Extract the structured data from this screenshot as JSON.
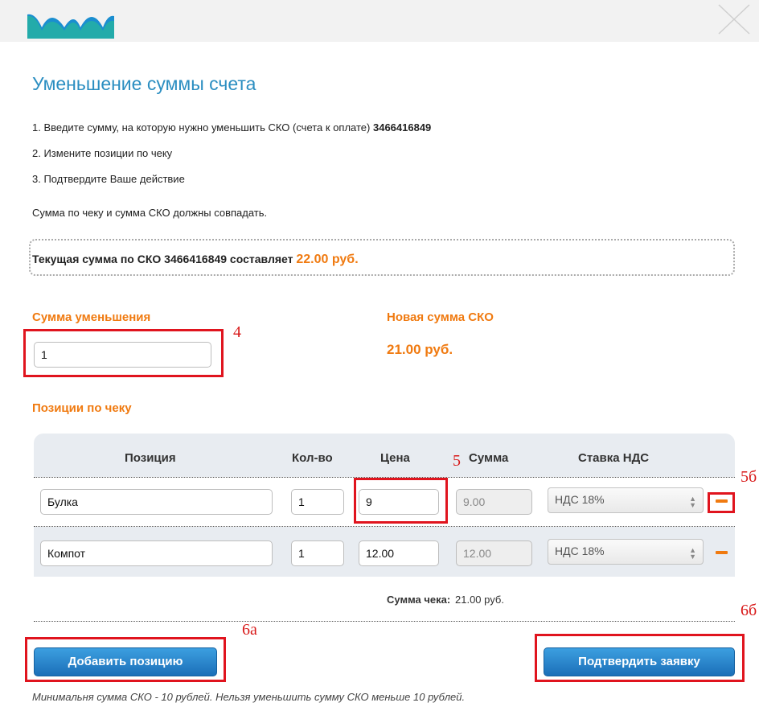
{
  "header": {
    "logo": "logo-icon",
    "close": "close-icon"
  },
  "title": "Уменьшение суммы счета",
  "steps": {
    "s1_text": "1. Введите сумму, на которую нужно уменьшить СКО (счета к оплате) ",
    "s1_number": "3466416849",
    "s2": "2. Измените позиции по чеку",
    "s3": "3. Подтвердите Ваше действие"
  },
  "note": "Сумма по чеку и сумма СКО должны совпадать.",
  "current": {
    "prefix": "Текущая сумма по СКО 3466416849 составляет ",
    "amount": "22.00 руб."
  },
  "reduction": {
    "label": "Сумма уменьшения",
    "value": "1"
  },
  "new_sum": {
    "label": "Новая сумма СКО",
    "value": "21.00 руб."
  },
  "positions_label": "Позиции по чеку",
  "table": {
    "headers": {
      "position": "Позиция",
      "qty": "Кол-во",
      "price": "Цена",
      "sum": "Сумма",
      "vat": "Ставка НДС"
    },
    "rows": [
      {
        "name": "Булка",
        "qty": "1",
        "price": "9",
        "sum": "9.00",
        "vat": "НДС 18%"
      },
      {
        "name": "Компот",
        "qty": "1",
        "price": "12.00",
        "sum": "12.00",
        "vat": "НДС 18%"
      }
    ]
  },
  "total": {
    "label": "Сумма чека:",
    "value": "21.00 руб."
  },
  "buttons": {
    "add": "Добавить позицию",
    "confirm": "Подтвердить заявку"
  },
  "footnote": "Минимальня сумма СКО - 10 рублей. Нельзя уменьшить сумму СКО меньше 10 рублей.",
  "annotations": {
    "a4": "4",
    "a5": "5",
    "a5b": "5б",
    "a6a": "6а",
    "a6b": "6б"
  },
  "colors": {
    "accent": "#f07a10",
    "title": "#2b8ec1",
    "button": "#1b6fb8",
    "annotation": "#e0141e"
  }
}
